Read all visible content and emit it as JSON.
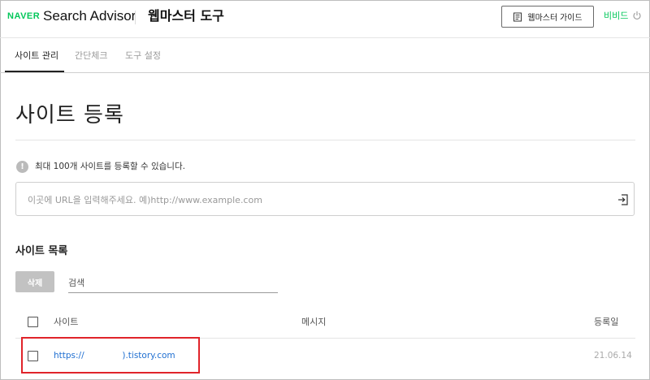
{
  "header": {
    "logo": "NAVER",
    "brand": "Search Advisor",
    "title": "웹마스터 도구",
    "guide_button": "웹마스터 가이드",
    "user": "비비드"
  },
  "tabs": [
    {
      "label": "사이트 관리",
      "active": true
    },
    {
      "label": "간단체크",
      "active": false
    },
    {
      "label": "도구 설정",
      "active": false
    }
  ],
  "main": {
    "title": "사이트 등록",
    "notice": "최대 100개 사이트를 등록할 수 있습니다.",
    "url_placeholder": "이곳에 URL을 입력해주세요. 예)http://www.example.com",
    "list_title": "사이트 목록",
    "delete_button": "삭제",
    "search_placeholder": "검색",
    "columns": [
      "사이트",
      "메시지",
      "등록일"
    ],
    "rows": [
      {
        "site": "https://              ).tistory.com",
        "message": "",
        "date": "21.06.14"
      }
    ]
  },
  "colors": {
    "brand_green": "#03c75a",
    "link_blue": "#1f6fd1",
    "highlight_red": "#e0242a"
  }
}
